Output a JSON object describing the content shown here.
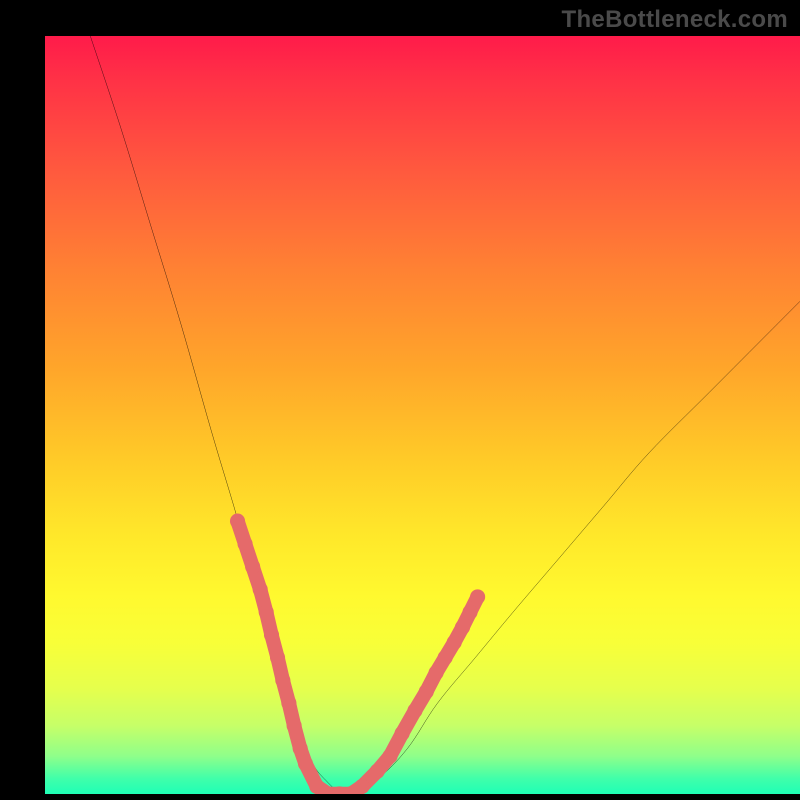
{
  "attribution": "TheBottleneck.com",
  "chart_data": {
    "type": "line",
    "title": "",
    "xlabel": "",
    "ylabel": "",
    "xlim": [
      0,
      100
    ],
    "ylim": [
      0,
      100
    ],
    "grid": false,
    "legend": false,
    "series": [
      {
        "name": "bottleneck-curve",
        "color": "#000000",
        "x": [
          6,
          10,
          14,
          18,
          22,
          25,
          27,
          29,
          31,
          33,
          35,
          37,
          40,
          44,
          48,
          52,
          57,
          62,
          68,
          74,
          80,
          88,
          96,
          100
        ],
        "y": [
          100,
          88,
          75,
          62,
          48,
          38,
          31,
          25,
          18,
          11,
          5,
          2,
          0,
          2,
          6,
          12,
          18,
          24,
          31,
          38,
          45,
          53,
          61,
          65
        ]
      },
      {
        "name": "highlight-dots",
        "color": "#e56a6a",
        "type": "scatter",
        "x": [
          25.5,
          26.5,
          27.5,
          28.5,
          29.3,
          30.0,
          30.8,
          31.5,
          32.3,
          33.0,
          33.8,
          34.5,
          36.0,
          37.5,
          39.0,
          40.5,
          42.0,
          44.0,
          45.7,
          47.3,
          49.0,
          50.5,
          51.8,
          53.0,
          54.2,
          55.3,
          56.3,
          57.3
        ],
        "y": [
          36,
          33,
          30,
          27,
          24,
          21,
          18,
          15,
          12,
          9,
          6,
          4,
          1,
          0,
          0,
          0,
          1,
          3,
          5,
          8,
          11,
          13.5,
          16,
          18,
          20,
          22,
          24,
          26
        ]
      }
    ],
    "background_gradient": {
      "top": "#ff1b4a",
      "mid": "#ffe82a",
      "bottom": "#1fffb6"
    }
  }
}
